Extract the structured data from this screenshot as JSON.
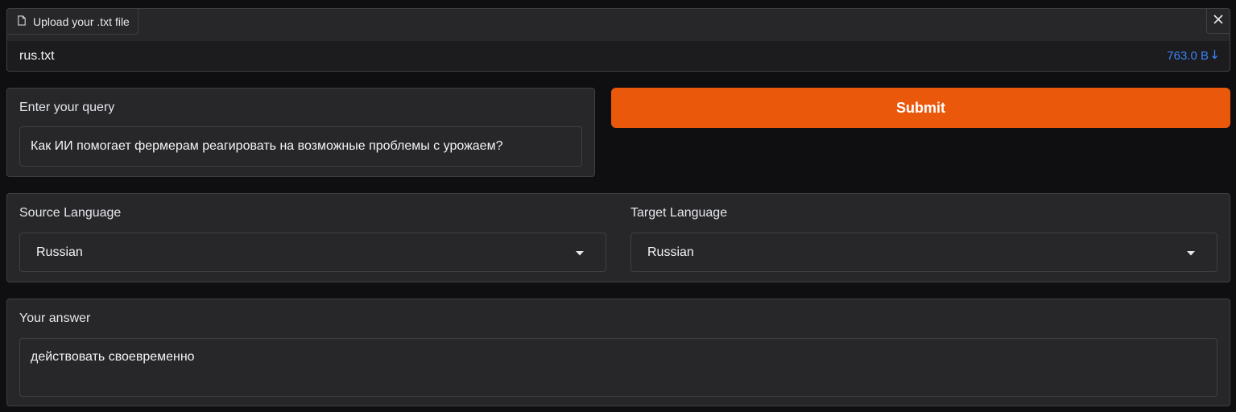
{
  "file_upload": {
    "label": "Upload your .txt file",
    "file_name": "rus.txt",
    "file_size": "763.0 B",
    "icons": {
      "label": "file-icon",
      "close": "close-icon",
      "download": "download-arrow-icon"
    }
  },
  "query": {
    "label": "Enter your query",
    "value": "Как ИИ помогает фермерам реагировать на возможные проблемы с урожаем?"
  },
  "submit": {
    "label": "Submit",
    "color": "#ea580c"
  },
  "languages": {
    "source": {
      "label": "Source Language",
      "selected": "Russian"
    },
    "target": {
      "label": "Target Language",
      "selected": "Russian"
    }
  },
  "answer": {
    "label": "Your answer",
    "value": "действовать своевременно"
  },
  "colors": {
    "background": "#0f0f11",
    "panel": "#27272a",
    "border": "#3f3f46",
    "link": "#3b82f6"
  }
}
